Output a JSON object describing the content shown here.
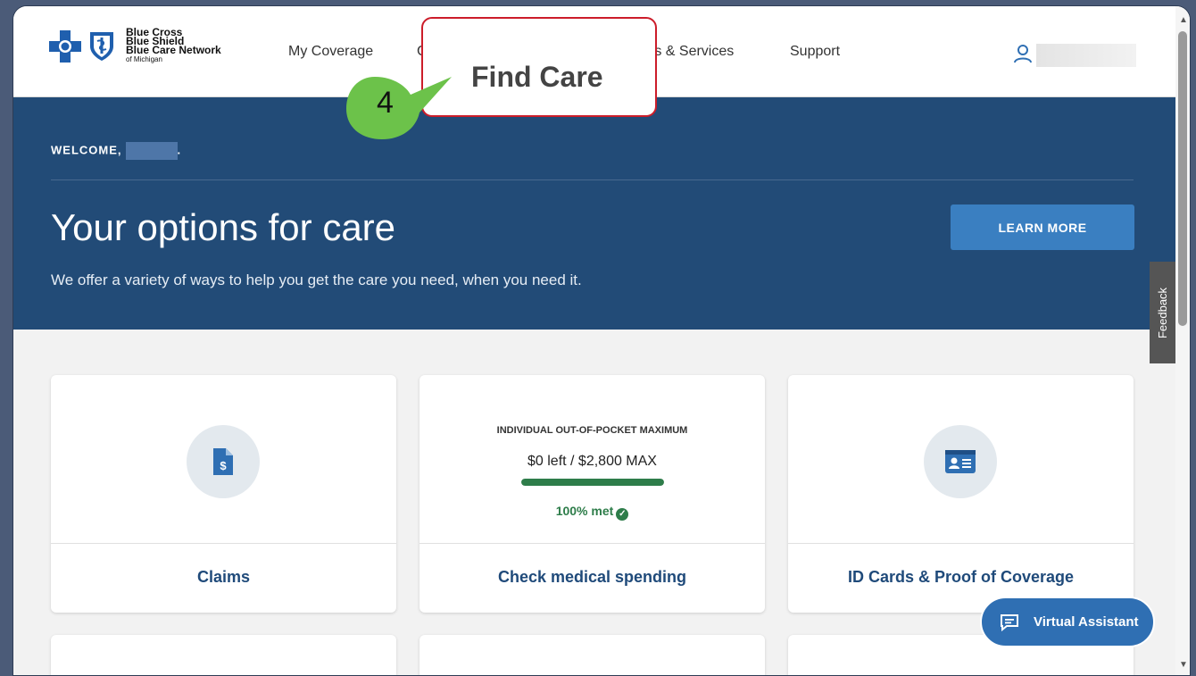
{
  "header": {
    "logo": {
      "line1": "Blue Cross",
      "line2": "Blue Shield",
      "line3": "Blue Care Network",
      "line4": "of Michigan"
    },
    "nav": {
      "my_coverage": "My Coverage",
      "partial_c": "C",
      "programs_services": "ms & Services",
      "support": "Support"
    }
  },
  "hero": {
    "welcome": "WELCOME,",
    "welcome_end": ".",
    "title": "Your options for care",
    "subtitle": "We offer a variety of ways to help you get the care you need, when you need it.",
    "learn_more": "LEARN MORE"
  },
  "feedback": "Feedback",
  "cards": {
    "claims": {
      "label": "Claims",
      "icon": "dollar-document-icon"
    },
    "spending": {
      "title": "INDIVIDUAL OUT-OF-POCKET MAXIMUM",
      "value": "$0 left / $2,800 MAX",
      "progress_fraction": 1.0,
      "met": "100% met",
      "label": "Check medical spending"
    },
    "id_cards": {
      "label": "ID Cards & Proof of Coverage",
      "icon": "id-card-icon"
    }
  },
  "virtual_assistant": "Virtual Assistant",
  "annotation": {
    "callout": "Find Care",
    "step": "4"
  },
  "colors": {
    "brand_navy": "#224b77",
    "button_blue": "#3a7fc1",
    "success_green": "#2e7d4a",
    "callout_red": "#cc1d2a",
    "step_green": "#6cc24a"
  }
}
